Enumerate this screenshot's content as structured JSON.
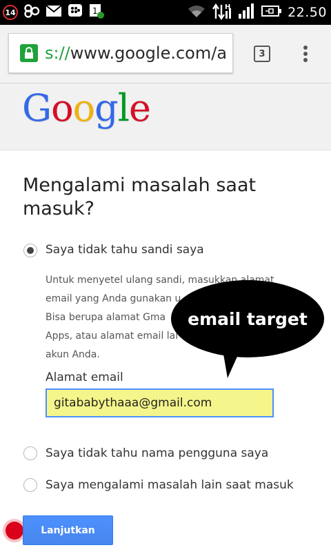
{
  "status_bar": {
    "notification_count": "14",
    "time": "22.50",
    "icons": [
      "notification-count-icon",
      "infinity-icon",
      "mail-icon",
      "bbm-icon",
      "sync-icon",
      "wifi-icon",
      "data-transfer-icon",
      "signal-icon",
      "battery-icon"
    ]
  },
  "browser": {
    "url_scheme": "s://",
    "url_rest": "www.google.com/a",
    "tab_count": "3"
  },
  "header": {
    "logo_letters": [
      "G",
      "o",
      "o",
      "g",
      "l",
      "e"
    ],
    "logo_colors": [
      "#3369e8",
      "#d50f25",
      "#eeb211",
      "#3369e8",
      "#009925",
      "#d50f25"
    ]
  },
  "main": {
    "title": "Mengalami masalah saat masuk?",
    "options": [
      {
        "label": "Saya tidak tahu sandi saya",
        "checked": true
      },
      {
        "label": "Saya tidak tahu nama pengguna saya",
        "checked": false
      },
      {
        "label": "Saya mengalami masalah lain saat masuk",
        "checked": false
      }
    ],
    "description_lines": [
      "Untuk menyetel ulang sandi, masukkan alamat",
      "email yang Anda gunakan u",
      "Bisa berupa alamat Gma",
      "Apps, atau alamat email lai",
      "akun Anda."
    ],
    "email_label": "Alamat email",
    "email_value": "gitababythaaa@gmail.com",
    "continue_button": "Lanjutkan"
  },
  "annotation": {
    "text": "email target"
  },
  "colors": {
    "primary_button": "#4d90fe",
    "lock_green": "#1fa23b",
    "input_highlight": "#f4f58a"
  }
}
